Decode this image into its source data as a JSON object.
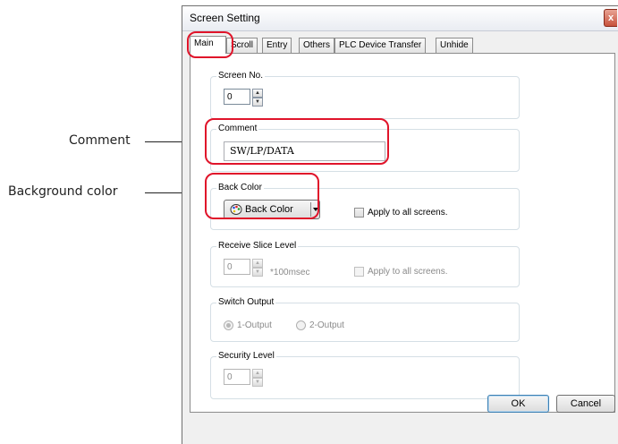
{
  "annotations": {
    "comment_label": "Comment",
    "background_label": "Background color"
  },
  "dialog": {
    "title": "Screen Setting",
    "close_glyph": "x",
    "tabs": [
      {
        "label": "Main",
        "active": true
      },
      {
        "label": "Scroll",
        "active": false
      },
      {
        "label": "Entry",
        "active": false
      },
      {
        "label": "Others",
        "active": false
      },
      {
        "label": "PLC Device Transfer",
        "active": false
      },
      {
        "label": "Unhide",
        "active": false
      }
    ],
    "screen_no": {
      "label": "Screen No.",
      "value": "0"
    },
    "comment": {
      "label": "Comment",
      "value": "SW/LP/DATA"
    },
    "back_color": {
      "label": "Back Color",
      "button_label": "Back Color",
      "button_icon": "palette-icon",
      "dropdown_icon": "dropdown-arrow-icon",
      "apply_all_label": "Apply to all screens.",
      "apply_all_checked": false
    },
    "receive_slice": {
      "label": "Receive Slice Level",
      "value": "0",
      "unit": "*100msec",
      "apply_all_label": "Apply to all screens.",
      "apply_all_checked": false,
      "enabled": false
    },
    "switch_output": {
      "label": "Switch Output",
      "options": [
        "1-Output",
        "2-Output"
      ],
      "selected": "1-Output",
      "enabled": false
    },
    "security_level": {
      "label": "Security Level",
      "value": "0",
      "enabled": false
    },
    "buttons": {
      "ok": "OK",
      "cancel": "Cancel"
    },
    "highlight_color": "#e0142a"
  }
}
